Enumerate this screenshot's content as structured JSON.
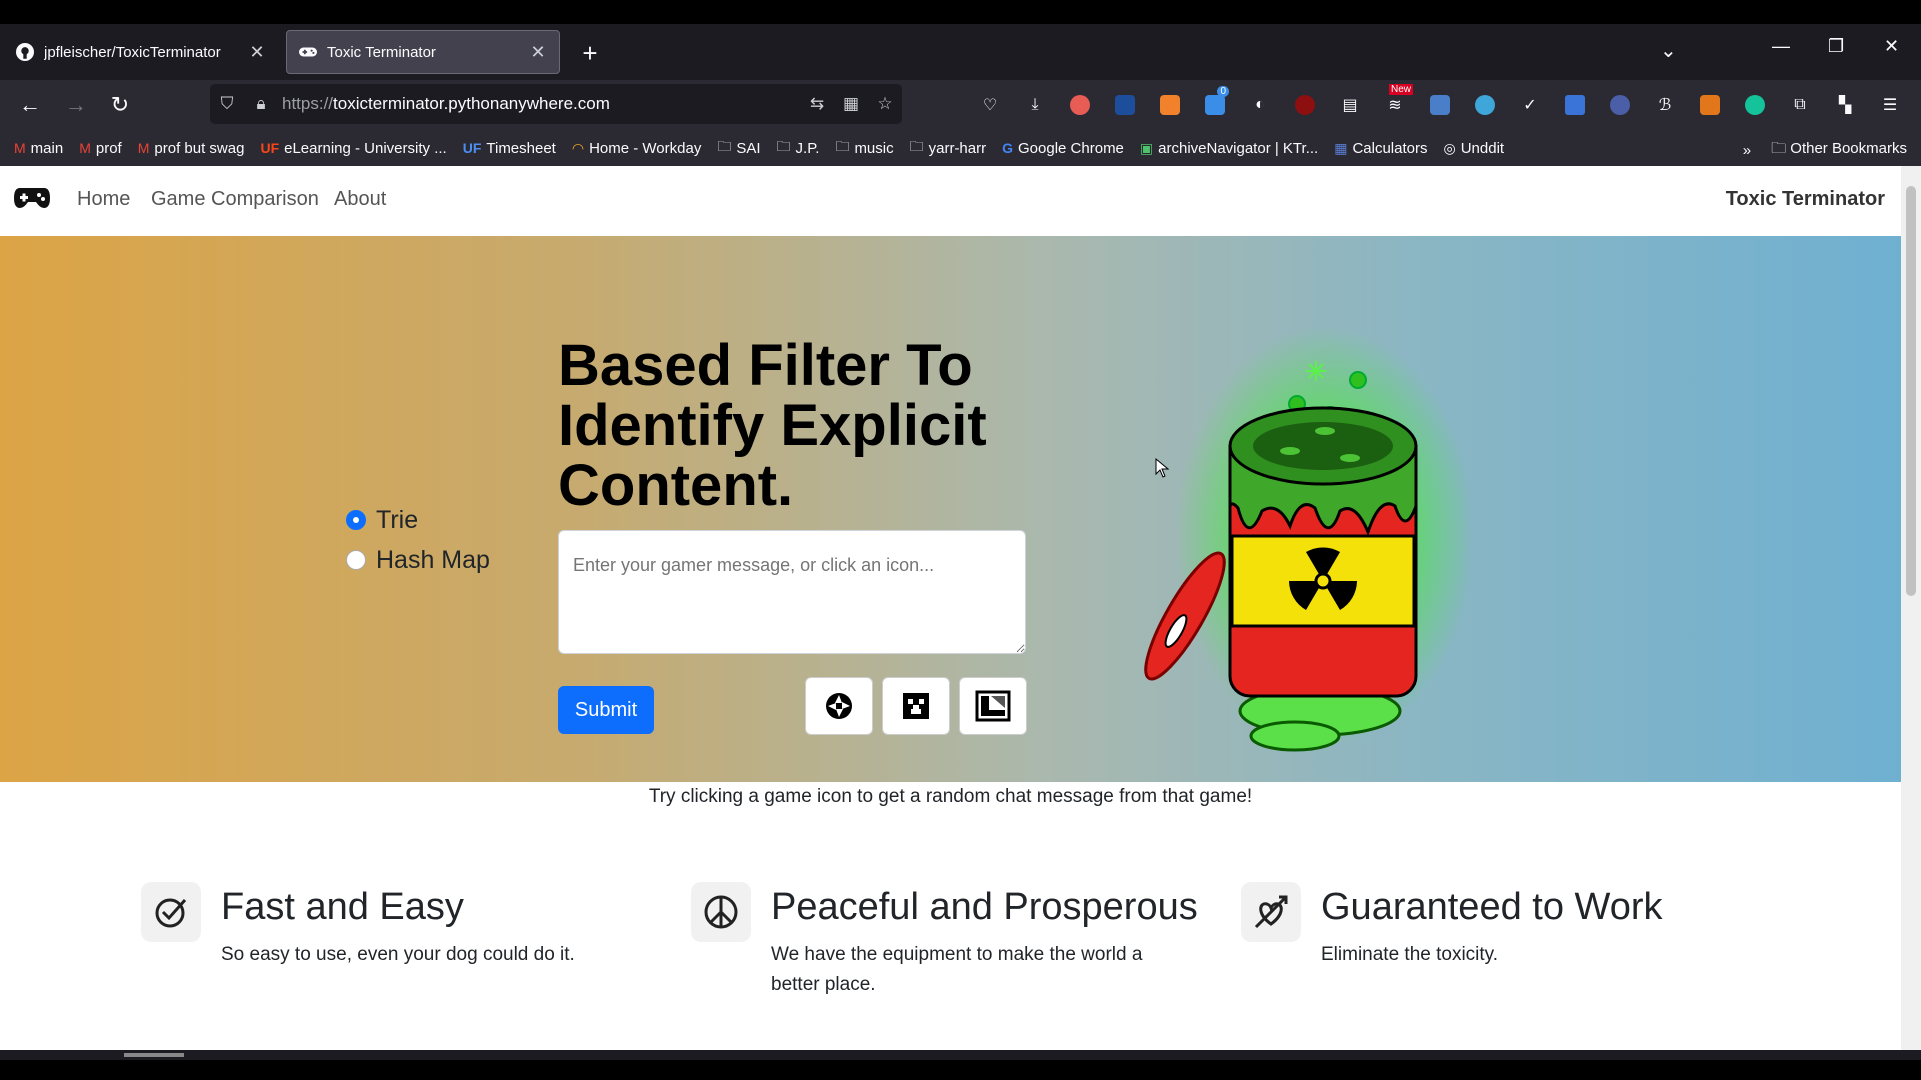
{
  "browser": {
    "tabs": [
      {
        "title": "jpfleischer/ToxicTerminator",
        "active": false
      },
      {
        "title": "Toxic Terminator",
        "active": true
      }
    ],
    "url_scheme": "https://",
    "url_host": "toxicterminator.pythonanywhere.com",
    "bookmarks": [
      "main",
      "prof",
      "prof but swag",
      "eLearning - University ...",
      "Timesheet",
      "Home - Workday",
      "SAI",
      "J.P.",
      "music",
      "yarr-harr",
      "Google Chrome",
      "archiveNavigator | KTr...",
      "Calculators",
      "Unddit"
    ],
    "other_bookmarks": "Other Bookmarks",
    "extension_badges": {
      "notify_count": "0",
      "new_label": "New"
    }
  },
  "site": {
    "nav": {
      "home": "Home",
      "game_comparison": "Game Comparison",
      "about": "About",
      "brand": "Toxic Terminator"
    },
    "hero": {
      "title": "Based Filter To Identify Explicit Content.",
      "radio_options": [
        {
          "label": "Trie",
          "checked": true
        },
        {
          "label": "Hash Map",
          "checked": false
        }
      ],
      "message_placeholder": "Enter your gamer message, or click an icon...",
      "submit_label": "Submit",
      "game_icons": [
        "valorant-icon",
        "minecraft-icon",
        "league-icon"
      ]
    },
    "caption": "Try clicking a game icon to get a random chat message from that game!",
    "features": [
      {
        "icon": "check-circle-icon",
        "title": "Fast and Easy",
        "text": "So easy to use, even your dog could do it."
      },
      {
        "icon": "peace-icon",
        "title": "Peaceful and Prosperous",
        "text": "We have the equipment to make the world a better place."
      },
      {
        "icon": "arrow-heart-icon",
        "title": "Guaranteed to Work",
        "text": "Eliminate the toxicity."
      }
    ]
  },
  "colors": {
    "accent": "#0d6efd",
    "hero_left": "#dca445",
    "hero_right": "#6fb0d1",
    "toxic_green": "#3bd12f",
    "barrel_red": "#e52620",
    "barrel_yellow": "#f4e10a"
  }
}
